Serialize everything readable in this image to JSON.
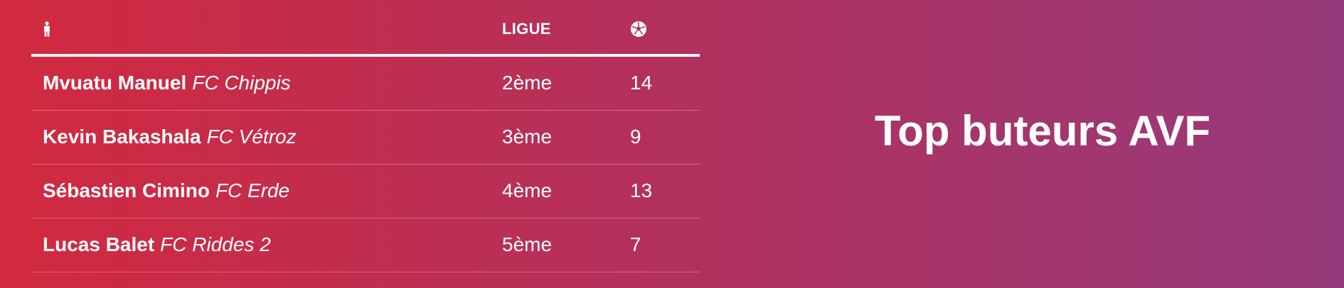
{
  "colors": {
    "gradient_start": "#d2293f",
    "gradient_mid": "#b5305a",
    "gradient_end": "#963a7b",
    "text": "#ffffff"
  },
  "table": {
    "headers": {
      "player_icon": "person-icon",
      "league": "LIGUE",
      "goals_icon": "soccer-ball-icon"
    },
    "rows": [
      {
        "name": "Mvuatu Manuel",
        "club": "FC Chippis",
        "league": "2ème",
        "goals": "14"
      },
      {
        "name": "Kevin Bakashala",
        "club": "FC Vétroz",
        "league": "3ème",
        "goals": "9"
      },
      {
        "name": "Sébastien Cimino",
        "club": "FC Erde",
        "league": "4ème",
        "goals": "13"
      },
      {
        "name": "Lucas Balet",
        "club": "FC Riddes 2",
        "league": "5ème",
        "goals": "7"
      }
    ]
  },
  "title": "Top buteurs AVF"
}
